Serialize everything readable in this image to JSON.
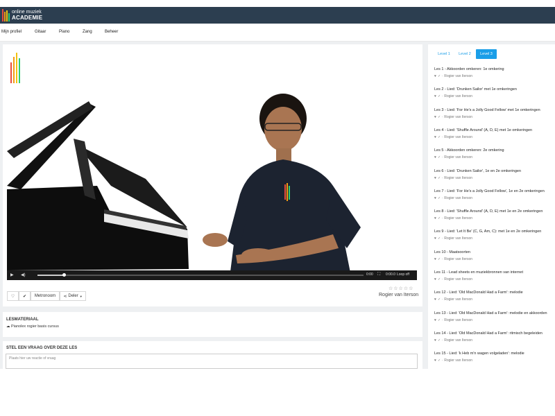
{
  "header": {
    "logo_line1": "online muziek",
    "logo_line2": "ACADEMIE",
    "logo_colors": [
      "#e74c3c",
      "#f39c12",
      "#f1c40f",
      "#2ecc71"
    ]
  },
  "nav": {
    "items": [
      {
        "label": "Mijn profiel"
      },
      {
        "label": "Gitaar"
      },
      {
        "label": "Piano"
      },
      {
        "label": "Zang"
      },
      {
        "label": "Beheer"
      }
    ]
  },
  "video": {
    "time_current": "0:00",
    "time_total": "0:00.0",
    "loop_label": "Loop off",
    "progress_fraction": 0.08,
    "brand_colors": [
      "#e74c3c",
      "#f39c12",
      "#f1c40f",
      "#2ecc71"
    ]
  },
  "actions": {
    "metronome_label": "Metronoom",
    "share_label": "Deler"
  },
  "rating": {
    "stars": "☆☆☆☆☆",
    "author": "Rogier van Iterson"
  },
  "lesmateriaal": {
    "title": "LESMATERIAAL",
    "file_label": "Pianolex rogier basis cursus"
  },
  "question": {
    "title": "STEL EEN VRAAG OVER DEZE LES",
    "placeholder": "Plaats hier uw reactie of vraag"
  },
  "levels": {
    "tabs": [
      {
        "label": "Level 1",
        "active": false
      },
      {
        "label": "Level 2",
        "active": false
      },
      {
        "label": "Level 3",
        "active": true
      }
    ],
    "active_color": "#1a9ee8"
  },
  "lessons": [
    {
      "title": "Les 1 - Akkoorden omkeren: 1e omkering",
      "author": "Rogier van Iterson"
    },
    {
      "title": "Les 2 - Lied: 'Drunken Sailor' met 1e omkeringen",
      "author": "Rogier van Iterson"
    },
    {
      "title": "Les 3 - Lied: 'For He's a Jolly Good Fellow' met 1e omkeringen",
      "author": "Rogier van Iterson"
    },
    {
      "title": "Les 4 - Lied: 'Shuffle Around' (A, D, E) met 1e omkeringen",
      "author": "Rogier van Iterson"
    },
    {
      "title": "Les 5 - Akkoorden omkeren: 2e omkering",
      "author": "Rogier van Iterson"
    },
    {
      "title": "Les 6 - Lied: 'Drunken Sailor', 1e en 2e omkeringen",
      "author": "Rogier van Iterson"
    },
    {
      "title": "Les 7 - Lied: 'For He's a Jolly Good Fellow', 1e en 2e omkeringen",
      "author": "Rogier van Iterson"
    },
    {
      "title": "Les 8 - Lied: 'Shuffle Around' (A, D, E) met 1e en 2e omkeringen",
      "author": "Rogier van Iterson"
    },
    {
      "title": "Les 9 - Lied: 'Let It Be' (C, G, Am, C): met 1e en 2e omkeringen",
      "author": "Rogier van Iterson"
    },
    {
      "title": "Les 10 - Maatsoorten",
      "author": "Rogier van Iterson"
    },
    {
      "title": "Les 11 - Lead sheets en muziekbronnen van internet",
      "author": "Rogier van Iterson"
    },
    {
      "title": "Les 12 - Lied: 'Old MacDonald Had a Farm': melodie",
      "author": "Rogier van Iterson"
    },
    {
      "title": "Les 13 - Lied: 'Old MacDonald Had a Farm': melodie en akkoorden",
      "author": "Rogier van Iterson"
    },
    {
      "title": "Les 14 - Lied: 'Old MacDonald Had a Farm': ritmisch begeleiden",
      "author": "Rogier van Iterson"
    },
    {
      "title": "Les 15 - Lied: 'k Heb m'n wagen volgeladen': melodie",
      "author": "Rogier van Iterson"
    }
  ]
}
